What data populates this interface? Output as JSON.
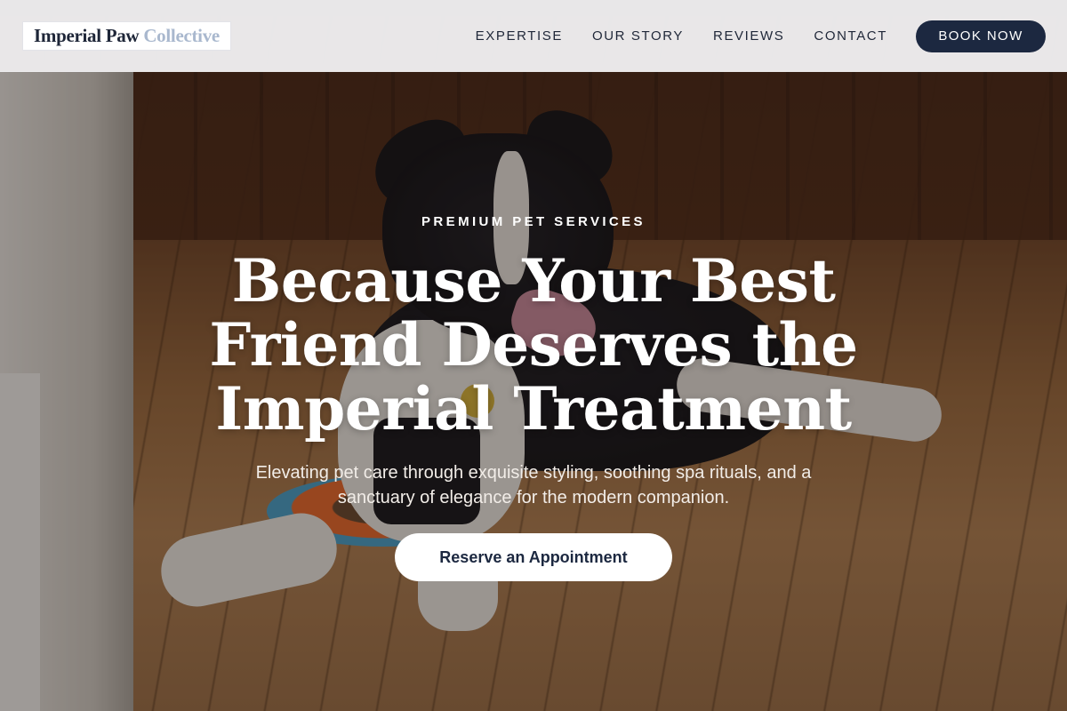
{
  "brand": {
    "name_primary": "Imperial Paw",
    "name_accent": "Collective"
  },
  "nav": {
    "items": [
      {
        "label": "EXPERTISE"
      },
      {
        "label": "OUR STORY"
      },
      {
        "label": "REVIEWS"
      },
      {
        "label": "CONTACT"
      }
    ],
    "book_label": "BOOK NOW"
  },
  "hero": {
    "eyebrow": "PREMIUM PET SERVICES",
    "headline": "Because Your Best Friend Deserves the Imperial Treatment",
    "subheadline": "Elevating pet care through exquisite styling, soothing spa rituals, and a sanctuary of elegance for the modern companion.",
    "cta_label": "Reserve an Appointment"
  },
  "colors": {
    "navy": "#1c2840",
    "logo_accent": "#a9b8ce",
    "header_bg": "#f0eff1"
  }
}
